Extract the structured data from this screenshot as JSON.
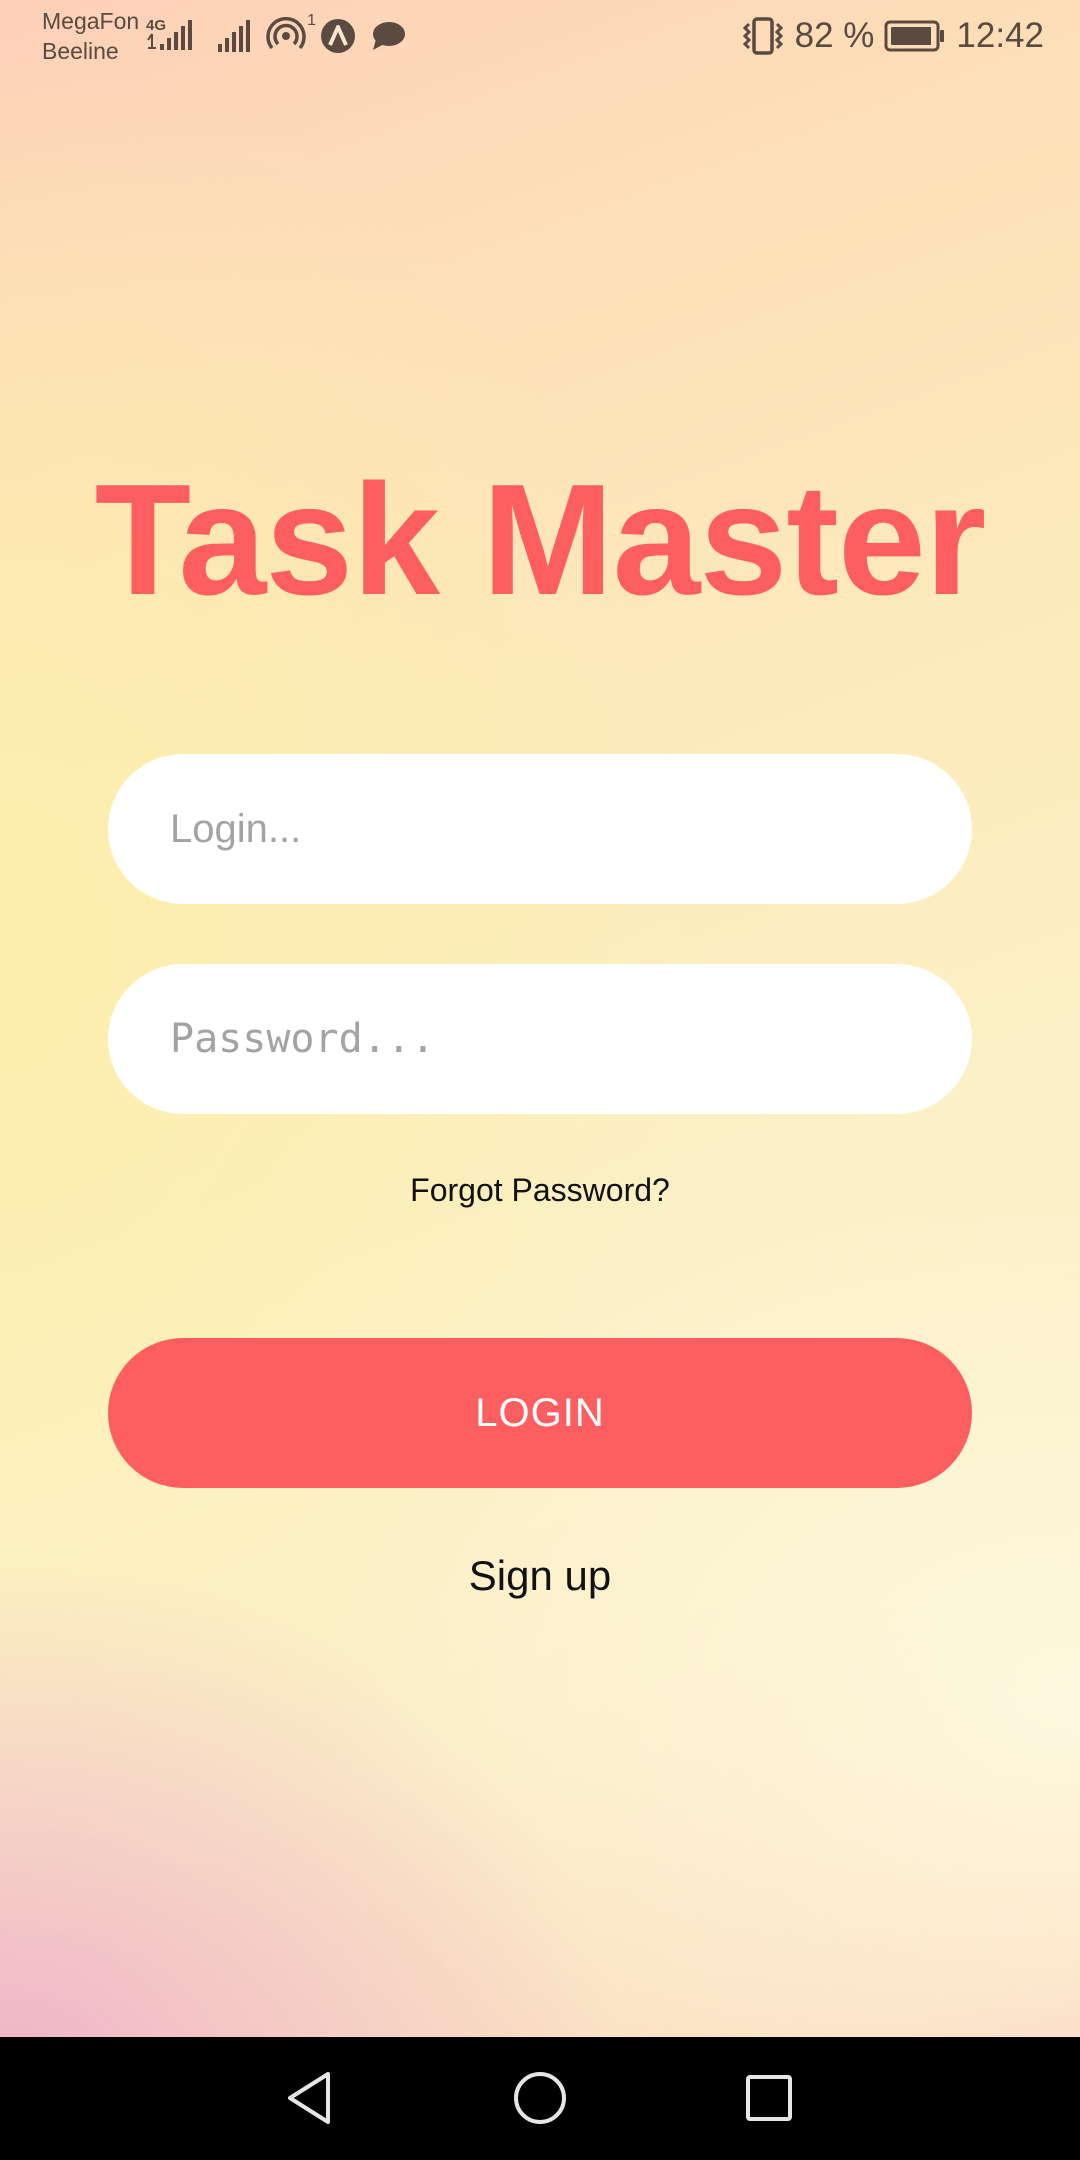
{
  "status_bar": {
    "carrier_1": "MegaFon",
    "carrier_2": "Beeline",
    "network_type": "4G",
    "hotspot_count": "1",
    "battery": "82 %",
    "time": "12:42"
  },
  "app": {
    "title": "Task Master",
    "login_placeholder": "Login...",
    "password_placeholder": "Password...",
    "forgot_password": "Forgot Password?",
    "login_button": "LOGIN",
    "signup": "Sign up"
  },
  "colors": {
    "accent": "#fd5e5f",
    "field_background": "#ffffff"
  },
  "nav_bar": {
    "icons": [
      "back-icon",
      "home-icon",
      "recent-apps-icon"
    ]
  }
}
